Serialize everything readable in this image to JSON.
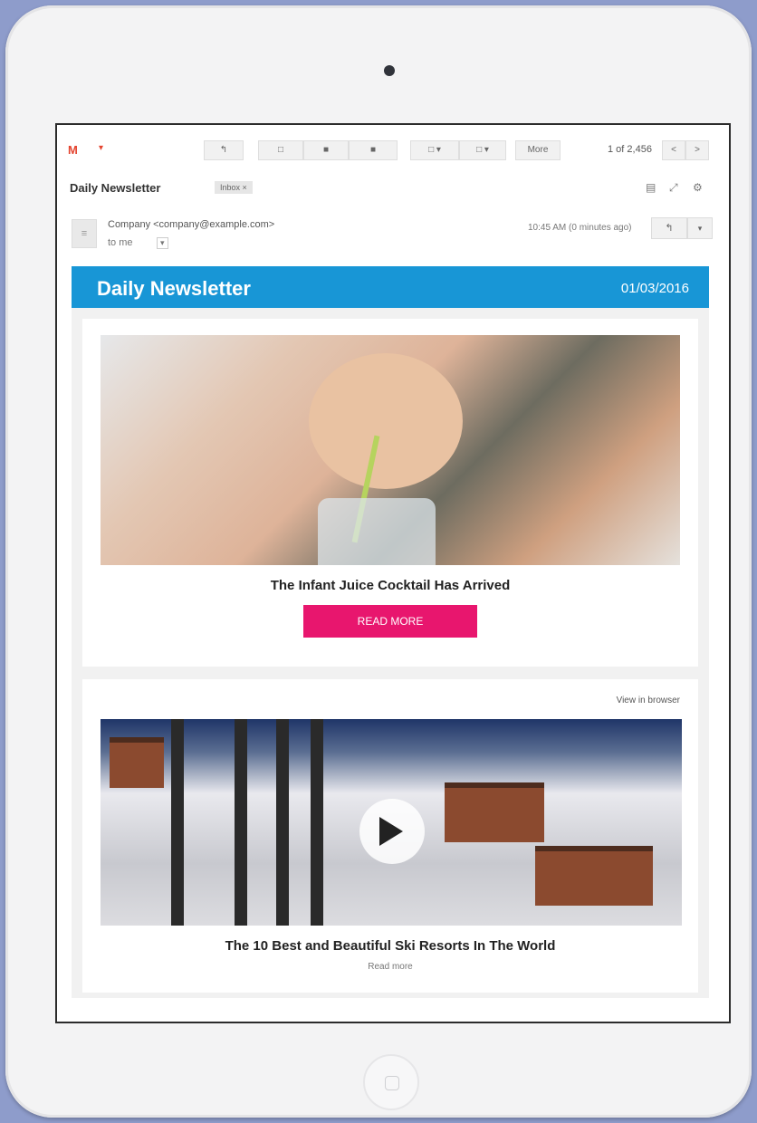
{
  "mail": {
    "logo": "M",
    "toolbar": {
      "buttons": [
        "↰",
        "□",
        "■",
        "■",
        "□ ▾",
        "□ ▾",
        "More"
      ],
      "count": "1 of 2,456",
      "prev": "<",
      "next": ">"
    },
    "subject": "Daily Newsletter",
    "inbox_tag": "Inbox ×",
    "subject_icons": [
      "print-icon",
      "expand-icon",
      "settings-icon"
    ],
    "sender": "Company <company@example.com>",
    "to": "to me",
    "time": "10:45 AM (0 minutes ago)",
    "reply": "↰",
    "more": "▾"
  },
  "newsletter": {
    "title": "Daily Newsletter",
    "date": "01/03/2016",
    "card1": {
      "title": "The Infant Juice Cocktail Has Arrived",
      "button": "READ MORE"
    },
    "card2": {
      "link": "View in browser",
      "title": "The 10 Best and Beautiful Ski Resorts In The World",
      "sub": "Read more"
    }
  },
  "colors": {
    "header_blue": "#1896d6",
    "cta_pink": "#e8166e",
    "logo_red": "#e4442f"
  }
}
